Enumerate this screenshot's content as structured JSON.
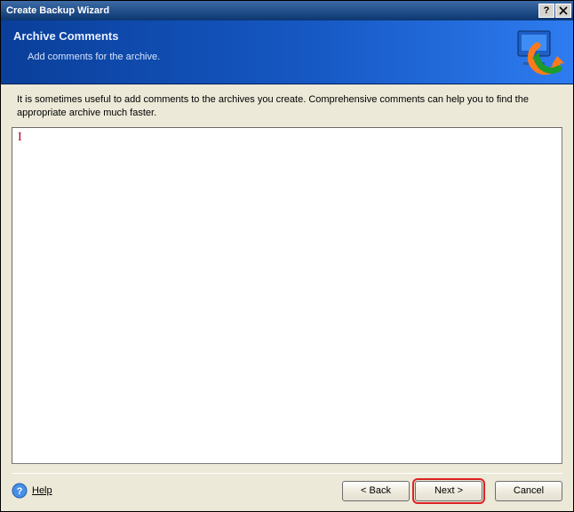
{
  "window": {
    "title": "Create Backup Wizard"
  },
  "header": {
    "step_title": "Archive Comments",
    "step_subtitle": "Add comments for the archive."
  },
  "content": {
    "description": "It is sometimes useful to add comments to the archives you create. Comprehensive comments can help you to find the appropriate archive much faster.",
    "comments_value": ""
  },
  "footer": {
    "help_label": "Help",
    "back_label": "< Back",
    "next_label": "Next >",
    "cancel_label": "Cancel"
  },
  "titlebar": {
    "help_glyph": "?",
    "close_glyph": "X"
  }
}
